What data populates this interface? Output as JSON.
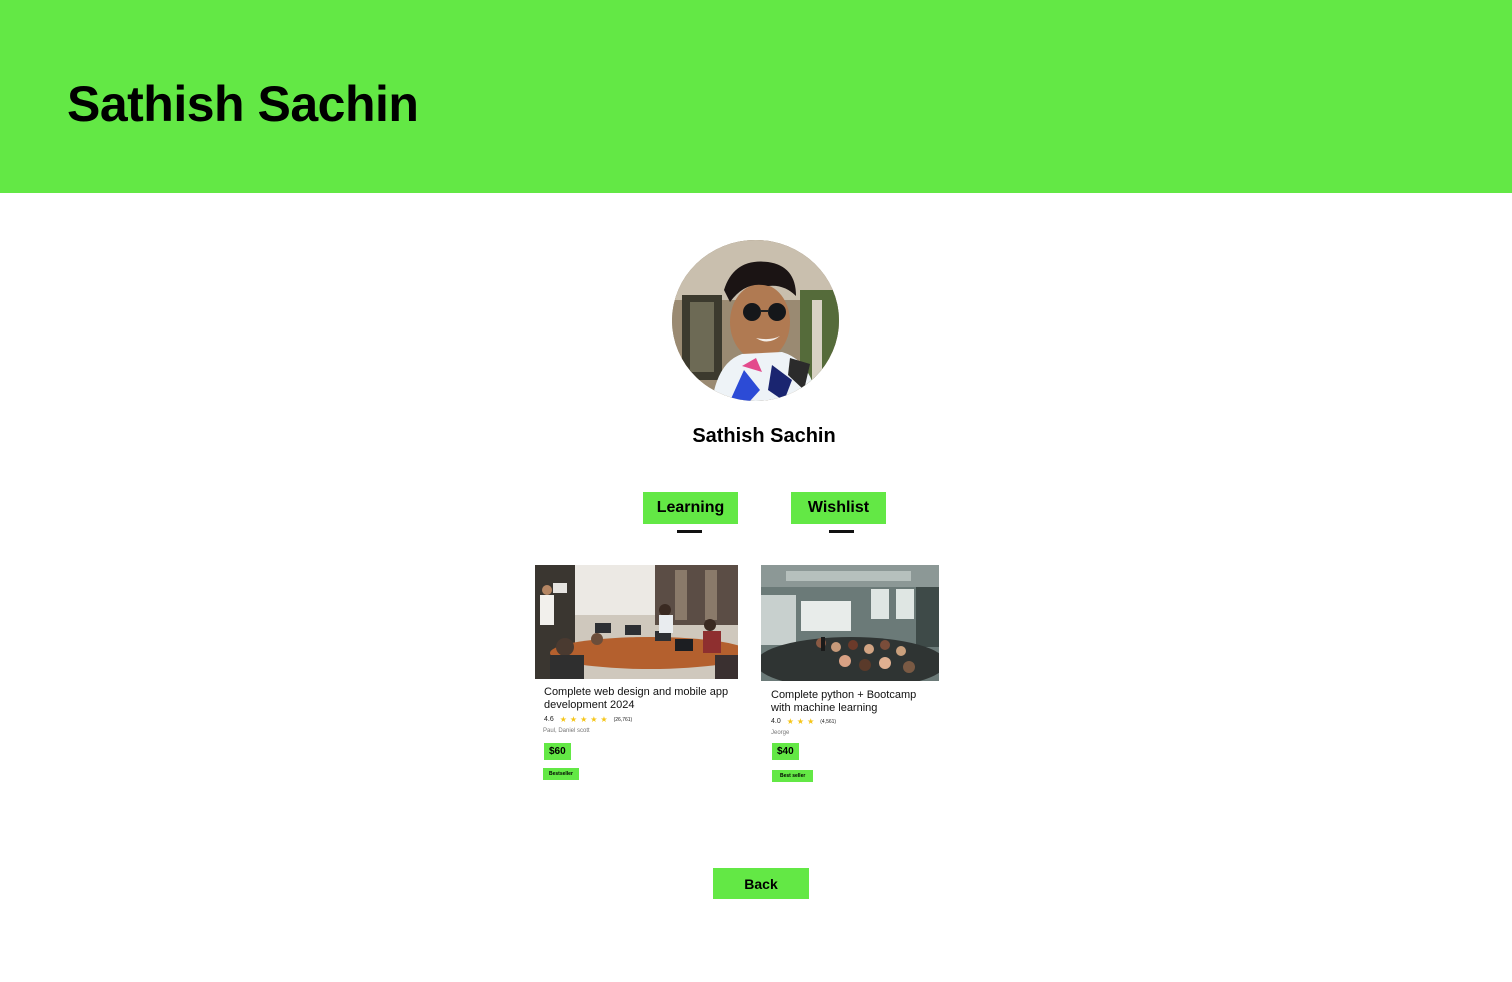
{
  "header": {
    "title": "Sathish Sachin"
  },
  "profile": {
    "name": "Sathish Sachin"
  },
  "tabs": [
    {
      "label": "Learning"
    },
    {
      "label": "Wishlist"
    }
  ],
  "courses": [
    {
      "title": "Complete web design and mobile app development 2024",
      "rating": "4.6",
      "stars": "★★★★★",
      "rating_count": "(26,761)",
      "authors": "Paul, Daniel scott",
      "price": "$60",
      "badge": "Bestseller"
    },
    {
      "title": "Complete python + Bootcamp with machine learning",
      "rating": "4.0",
      "stars": "★★★",
      "rating_count": "(4,561)",
      "authors": "Jeorge",
      "price": "$40",
      "badge": "Best seller"
    }
  ],
  "actions": {
    "back_label": "Back"
  },
  "colors": {
    "accent": "#63e845",
    "star": "#f5c518"
  }
}
